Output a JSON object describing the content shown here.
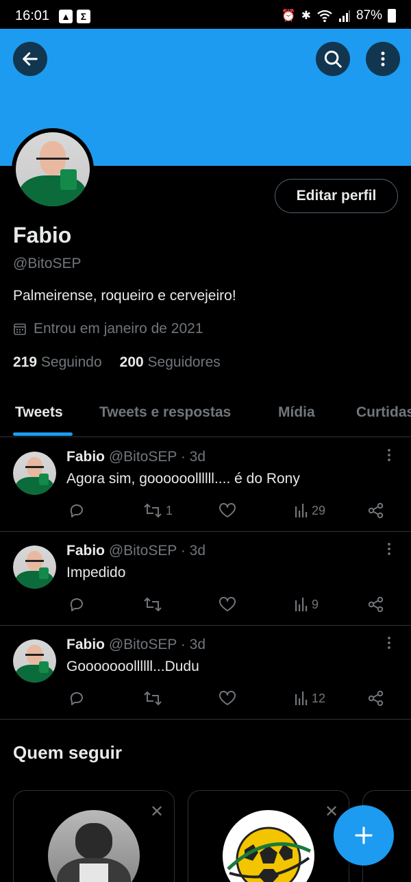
{
  "status_bar": {
    "time": "16:01",
    "battery": "87%"
  },
  "header": {
    "back_icon": "arrow-left-icon",
    "search_icon": "search-icon",
    "more_icon": "more-vertical-icon",
    "banner_color": "#1d9bf0"
  },
  "profile": {
    "name": "Fabio",
    "handle": "@BitoSEP",
    "bio": "Palmeirense, roqueiro e cervejeiro!",
    "joined": "Entrou em janeiro de 2021",
    "following_count": "219",
    "following_label": "Seguindo",
    "followers_count": "200",
    "followers_label": "Seguidores",
    "edit_button": "Editar perfil"
  },
  "tabs": [
    {
      "label": "Tweets",
      "active": true
    },
    {
      "label": "Tweets e respostas",
      "active": false
    },
    {
      "label": "Mídia",
      "active": false
    },
    {
      "label": "Curtidas",
      "active": false
    }
  ],
  "tweets": [
    {
      "name": "Fabio",
      "handle": "@BitoSEP",
      "time": "· 3d",
      "text": "Agora sim, goooooollllll.... é do Rony",
      "retweets": "1",
      "views": "29"
    },
    {
      "name": "Fabio",
      "handle": "@BitoSEP",
      "time": "· 3d",
      "text": "Impedido",
      "retweets": "",
      "views": "9"
    },
    {
      "name": "Fabio",
      "handle": "@BitoSEP",
      "time": "· 3d",
      "text": "Gooooooollllll...Dudu",
      "retweets": "",
      "views": "12"
    }
  ],
  "who_to_follow": {
    "title": "Quem seguir"
  },
  "colors": {
    "accent": "#1d9bf0",
    "text": "#e7e9ea",
    "muted": "#71767b",
    "border": "#2f3336"
  }
}
